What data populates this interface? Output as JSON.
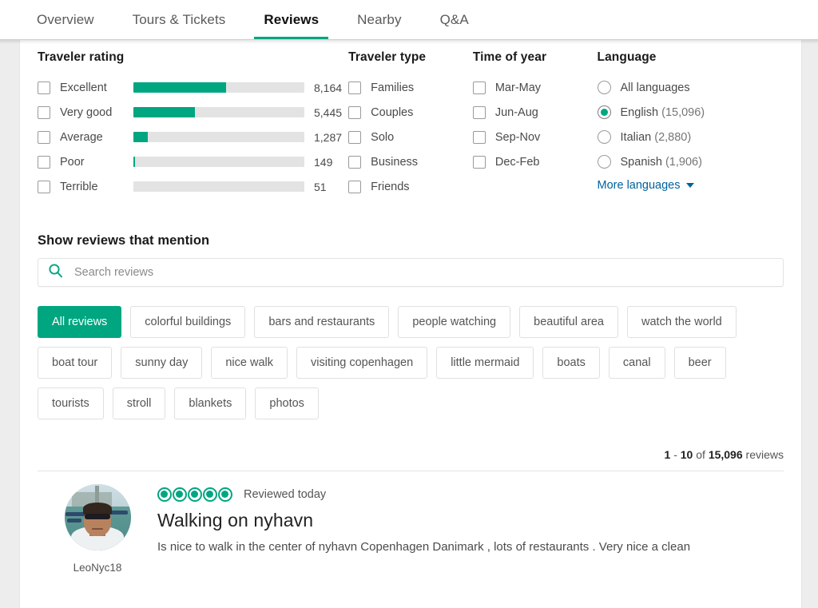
{
  "tabs": [
    {
      "label": "Overview",
      "active": false
    },
    {
      "label": "Tours & Tickets",
      "active": false
    },
    {
      "label": "Reviews",
      "active": true
    },
    {
      "label": "Nearby",
      "active": false
    },
    {
      "label": "Q&A",
      "active": false
    }
  ],
  "filters": {
    "traveler_rating": {
      "heading": "Traveler rating",
      "rows": [
        {
          "label": "Excellent",
          "count": "8,164",
          "percent": 54
        },
        {
          "label": "Very good",
          "count": "5,445",
          "percent": 36
        },
        {
          "label": "Average",
          "count": "1,287",
          "percent": 8.5
        },
        {
          "label": "Poor",
          "count": "149",
          "percent": 1
        },
        {
          "label": "Terrible",
          "count": "51",
          "percent": 0
        }
      ]
    },
    "traveler_type": {
      "heading": "Traveler type",
      "rows": [
        {
          "label": "Families"
        },
        {
          "label": "Couples"
        },
        {
          "label": "Solo"
        },
        {
          "label": "Business"
        },
        {
          "label": "Friends"
        }
      ]
    },
    "time_of_year": {
      "heading": "Time of year",
      "rows": [
        {
          "label": "Mar-May"
        },
        {
          "label": "Jun-Aug"
        },
        {
          "label": "Sep-Nov"
        },
        {
          "label": "Dec-Feb"
        }
      ]
    },
    "language": {
      "heading": "Language",
      "rows": [
        {
          "label": "All languages",
          "count": "",
          "selected": false
        },
        {
          "label": "English",
          "count": "(15,096)",
          "selected": true
        },
        {
          "label": "Italian",
          "count": "(2,880)",
          "selected": false
        },
        {
          "label": "Spanish",
          "count": "(1,906)",
          "selected": false
        }
      ],
      "more_label": "More languages"
    }
  },
  "mention": {
    "heading": "Show reviews that mention",
    "search_placeholder": "Search reviews",
    "search_value": "",
    "search_icon": "search-icon",
    "chips": [
      {
        "label": "All reviews",
        "active": true
      },
      {
        "label": "colorful buildings",
        "active": false
      },
      {
        "label": "bars and restaurants",
        "active": false
      },
      {
        "label": "people watching",
        "active": false
      },
      {
        "label": "beautiful area",
        "active": false
      },
      {
        "label": "watch the world",
        "active": false
      },
      {
        "label": "boat tour",
        "active": false
      },
      {
        "label": "sunny day",
        "active": false
      },
      {
        "label": "nice walk",
        "active": false
      },
      {
        "label": "visiting copenhagen",
        "active": false
      },
      {
        "label": "little mermaid",
        "active": false
      },
      {
        "label": "boats",
        "active": false
      },
      {
        "label": "canal",
        "active": false
      },
      {
        "label": "beer",
        "active": false
      },
      {
        "label": "tourists",
        "active": false
      },
      {
        "label": "stroll",
        "active": false
      },
      {
        "label": "blankets",
        "active": false
      },
      {
        "label": "photos",
        "active": false
      }
    ]
  },
  "pagination": {
    "range_start": "1",
    "dash": "-",
    "range_end": "10",
    "of": "of",
    "total": "15,096",
    "suffix": "reviews"
  },
  "reviews": [
    {
      "username": "LeoNyc18",
      "rating": 5,
      "max_rating": 5,
      "date": "Reviewed today",
      "title": "Walking on nyhavn",
      "text": "Is nice to walk in the center of nyhavn Copenhagen Danimark , lots of restaurants . Very nice a clean"
    }
  ],
  "colors": {
    "accent_green": "#00a680",
    "link_blue": "#00619e",
    "track_gray": "#e3e3e3",
    "text_dark": "#222222",
    "text_gray": "#4a4a4a"
  }
}
